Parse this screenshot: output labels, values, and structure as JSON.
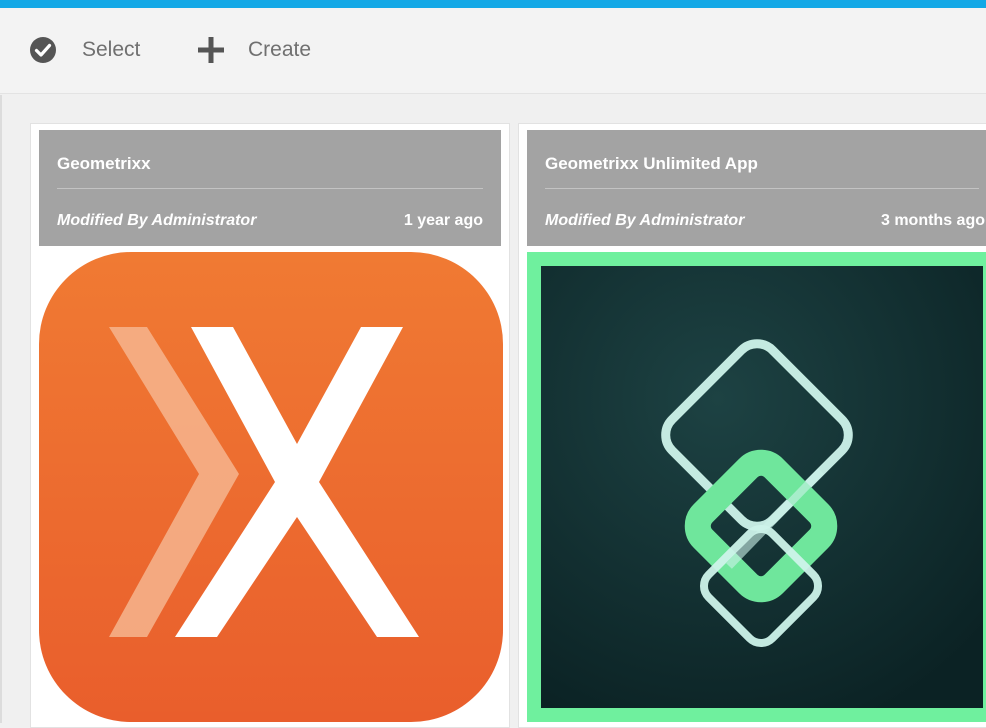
{
  "toolbar": {
    "select_label": "Select",
    "create_label": "Create",
    "select_icon": "check-circle-icon",
    "create_icon": "plus-icon"
  },
  "cards": [
    {
      "title": "Geometrixx",
      "modified": "Modified By Administrator",
      "time": "1 year ago",
      "thumbnail_icon": "geometrixx-orange-x-app-icon",
      "selected": false
    },
    {
      "title": "Geometrixx Unlimited App",
      "modified": "Modified By Administrator",
      "time": "3 months ago",
      "thumbnail_icon": "geometrixx-unlimited-diamond-app-icon",
      "selected": true
    }
  ],
  "colors": {
    "accent_bar": "#13a8e6",
    "header_gray": "#a3a3a3",
    "orange": "#ee6b2f",
    "selection_green": "#6ff09e",
    "dark_teal": "#0f2a2c"
  }
}
